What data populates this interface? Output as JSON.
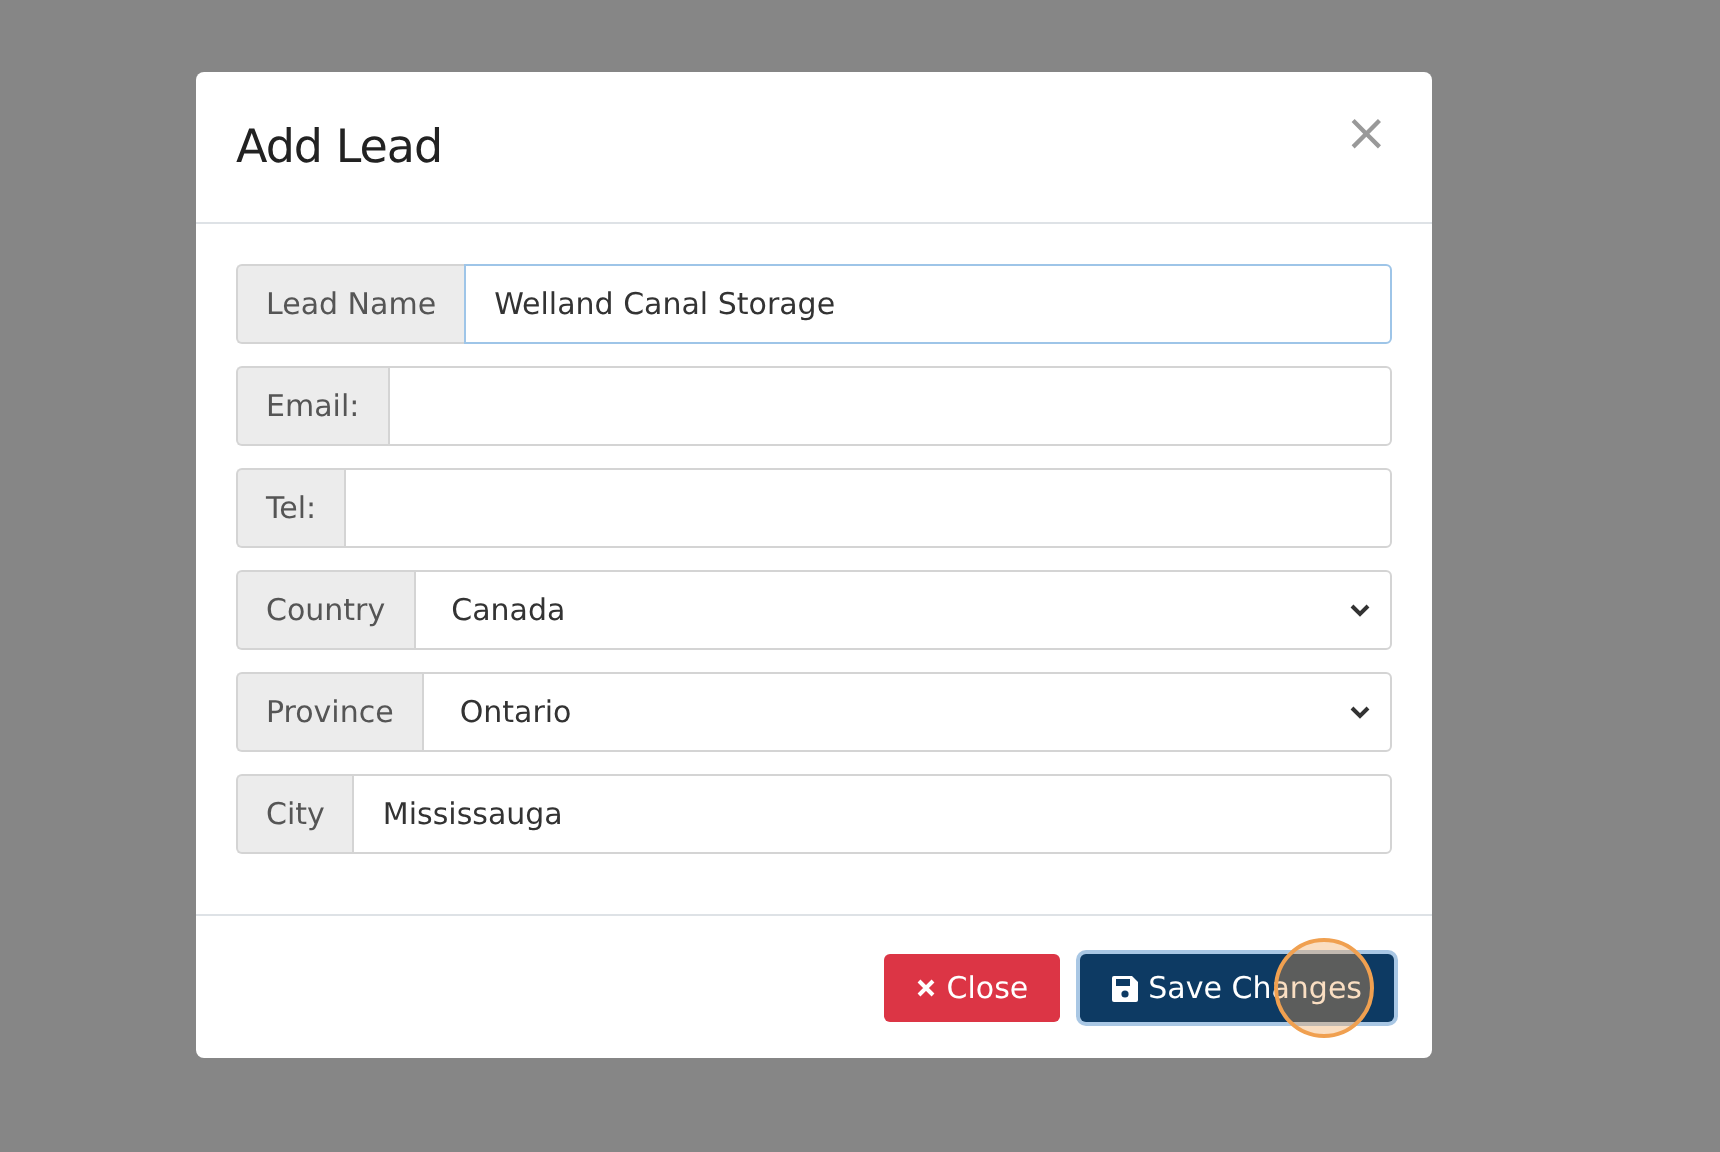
{
  "dialog": {
    "title": "Add Lead",
    "close_icon": "×"
  },
  "fields": [
    {
      "label": "Lead Name",
      "kind": "text",
      "value": "Welland Canal Storage",
      "focused": true
    },
    {
      "label": "Email:",
      "kind": "text",
      "focused": false
    },
    {
      "label": "Tel:",
      "kind": "text",
      "focused": false
    },
    {
      "label": "Country",
      "kind": "select",
      "value": "Canada",
      "focused": false
    },
    {
      "label": "Province",
      "kind": "select",
      "value": "Ontario",
      "focused": false
    },
    {
      "label": "City",
      "kind": "text",
      "value": "Mississauga",
      "focused": false
    }
  ],
  "buttons": [
    {
      "label": "Close",
      "kind": "close",
      "highlighted": false
    },
    {
      "label": "Save Changes",
      "kind": "save",
      "highlighted": true
    }
  ]
}
